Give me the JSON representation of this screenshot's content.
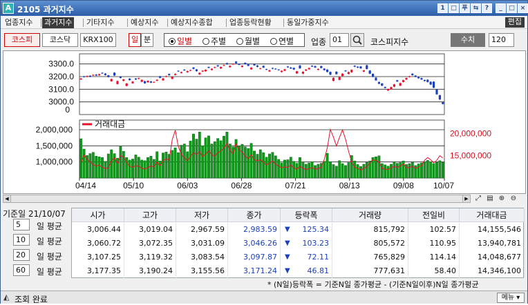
{
  "window": {
    "id": "2105",
    "title": "과거지수",
    "logo_glyph": "A"
  },
  "title_buttons": [
    {
      "name": "screen-num-button",
      "glyph": "1"
    },
    {
      "name": "layout-button",
      "glyph": "□"
    },
    {
      "name": "print-button",
      "glyph": "푸"
    },
    {
      "name": "link-button",
      "glyph": "⇆"
    },
    {
      "name": "help-button",
      "glyph": "?"
    },
    {
      "name": "minimize-button",
      "glyph": "_"
    },
    {
      "name": "maximize-button",
      "glyph": "□"
    },
    {
      "name": "close-button",
      "glyph": "×"
    }
  ],
  "menu_tabs": [
    "업종지수",
    "과거지수",
    "기타지수",
    "예상지수",
    "예상지수종합",
    "업종등락현황",
    "동일가중지수"
  ],
  "menu_active": 1,
  "edit_label": "편집",
  "markets": [
    "코스피",
    "코스닥",
    "KRX100"
  ],
  "market_selected": 0,
  "period_buttons": [
    "일",
    "분"
  ],
  "period_selected": 0,
  "radio_options": [
    "일별",
    "주별",
    "월별",
    "연별"
  ],
  "radio_selected": 0,
  "sector_label": "업종",
  "sector_code": "01",
  "sector_name": "코스피지수",
  "value_button": "수치",
  "count_value": "120",
  "chart_data": [
    {
      "type": "candlestick",
      "title": "",
      "y_ticks": [
        "3300.0",
        "3200.0",
        "3100.0",
        "3000.0",
        "0"
      ],
      "ylim": [
        2900,
        3380
      ],
      "x_labels": [
        "04/14",
        "05/10",
        "06/03",
        "06/28",
        "07/21",
        "08/13",
        "09/08",
        "10/07"
      ],
      "closes": [
        3185,
        3196,
        3205,
        3198,
        3214,
        3208,
        3219,
        3225,
        3212,
        3196,
        3181,
        3209,
        3165,
        3189,
        3178,
        3146,
        3172,
        3161,
        3177,
        3188,
        3174,
        3147,
        3167,
        3152,
        3158,
        3175,
        3190,
        3186,
        3204,
        3211,
        3198,
        3222,
        3241,
        3236,
        3249,
        3244,
        3252,
        3261,
        3243,
        3230,
        3247,
        3254,
        3269,
        3262,
        3275,
        3281,
        3276,
        3291,
        3297,
        3285,
        3302,
        3306,
        3293,
        3286,
        3298,
        3285,
        3271,
        3289,
        3277,
        3266,
        3271,
        3255,
        3250,
        3262,
        3258,
        3252,
        3246,
        3258,
        3273,
        3264,
        3256,
        3242,
        3265,
        3238,
        3256,
        3268,
        3279,
        3272,
        3260,
        3268,
        3251,
        3237,
        3215,
        3190,
        3219,
        3196,
        3223,
        3242,
        3236,
        3254,
        3278,
        3271,
        3265,
        3249,
        3260,
        3223,
        3198,
        3170,
        3143,
        3128,
        3110,
        3102,
        3117,
        3139,
        3161,
        3149,
        3172,
        3189,
        3203,
        3211,
        3198,
        3187,
        3177,
        3165,
        3157,
        3137,
        3112,
        3060,
        3019,
        2983
      ],
      "open_offsets": [
        -8,
        6,
        -7,
        9,
        -6,
        8,
        -9,
        5,
        12,
        14,
        -18,
        22,
        -24,
        10,
        -12,
        -20,
        12,
        -14,
        8,
        -6,
        -15,
        16,
        -12,
        10,
        -4,
        -8,
        12,
        -16,
        -6,
        10,
        -16,
        -9,
        5,
        -8,
        6,
        -10,
        -6,
        11,
        14,
        -13,
        -7,
        -12,
        7,
        -10,
        -6,
        8,
        -12,
        -5,
        10,
        -11,
        -6,
        13,
        7,
        -10,
        11,
        12,
        -14,
        10,
        11,
        -5,
        14,
        4,
        -10,
        6,
        5,
        4,
        -10,
        -12,
        7,
        8,
        13,
        -17,
        23,
        -15,
        -9,
        -10,
        7,
        11,
        -7,
        15,
        12,
        18,
        22,
        -24,
        20,
        -22,
        -18,
        6,
        -15,
        -20,
        8,
        7,
        15,
        -10,
        30,
        25,
        24,
        22,
        14,
        18,
        8,
        -12,
        -18,
        -19,
        10,
        -21,
        -15,
        -12,
        -7,
        12,
        10,
        9,
        11,
        8,
        18,
        22,
        48,
        38,
        34,
        14
      ]
    },
    {
      "type": "bar",
      "title": "거래대금",
      "y_ticks": [
        "2,000,000",
        "1,500,000",
        "1,000,000"
      ],
      "right_ticks": [
        "20,000,000",
        "15,000,000"
      ],
      "ylim": [
        500000,
        2300000
      ],
      "series": [
        {
          "name": "",
          "values": [
            1720000,
            1400000,
            1200000,
            1260000,
            1300000,
            1180000,
            1160000,
            1140000,
            1020000,
            1250000,
            1380000,
            1260000,
            1120000,
            1480000,
            1330000,
            1140000,
            1060000,
            1090000,
            1220000,
            1150000,
            1060000,
            1040000,
            1140000,
            1180000,
            1080000,
            1320000,
            1030000,
            1280000,
            1310000,
            1240000,
            1360000,
            1440000,
            1290000,
            1520000,
            1560000,
            1320000,
            1650000,
            1870000,
            1710000,
            1930000,
            1500000,
            1750000,
            1810000,
            1560000,
            1630000,
            1730000,
            1660000,
            1800000,
            1930000,
            1560000,
            1470000,
            1700000,
            1500000,
            1550000,
            1470000,
            1420000,
            1580000,
            1340000,
            1240000,
            1380000,
            1290000,
            1150000,
            1250000,
            1300000,
            1190000,
            1080000,
            970000,
            1060000,
            1070000,
            1150000,
            1020000,
            960000,
            1140000,
            1000000,
            930000,
            970000,
            1010000,
            890000,
            930000,
            960000,
            1020000,
            1270000,
            1010000,
            920000,
            870000,
            1040000,
            950000,
            890000,
            980000,
            1200000,
            1030000,
            920000,
            860000,
            930000,
            990000,
            1030000,
            1140000,
            1160000,
            1190000,
            950000,
            910000,
            870000,
            930000,
            1010000,
            960000,
            980000,
            1030000,
            920000,
            950000,
            990000,
            890000,
            940000,
            970000,
            1010000,
            1050000,
            1000000,
            950000,
            990000,
            1040000,
            990000
          ]
        },
        {
          "name": "거래대금",
          "values": [
            13400000,
            15300000,
            14200000,
            13600000,
            13000000,
            12700000,
            12900000,
            12400000,
            12100000,
            12300000,
            13800000,
            14600000,
            13300000,
            15000000,
            14700000,
            13500000,
            12600000,
            12400000,
            12800000,
            12600000,
            12200000,
            12000000,
            12400000,
            12700000,
            12500000,
            13600000,
            12700000,
            13900000,
            14300000,
            14000000,
            18600000,
            20700000,
            17100000,
            15300000,
            14600000,
            13900000,
            14800000,
            15700000,
            15300000,
            15900000,
            14800000,
            15400000,
            16100000,
            15200000,
            14900000,
            15700000,
            16100000,
            16700000,
            17700000,
            16200000,
            15400000,
            17800000,
            16300000,
            15800000,
            14900000,
            14300000,
            15300000,
            14100000,
            13900000,
            14100000,
            13600000,
            12900000,
            13400000,
            13800000,
            13100000,
            12700000,
            12300000,
            12500000,
            12400000,
            12900000,
            12300000,
            12000000,
            12600000,
            12200000,
            11900000,
            12100000,
            12400000,
            12000000,
            12100000,
            12400000,
            14200000,
            16800000,
            20900000,
            19200000,
            17200000,
            19100000,
            20800000,
            18700000,
            16000000,
            13600000,
            12400000,
            12200000,
            11800000,
            12200000,
            12500000,
            13400000,
            14100000,
            13900000,
            13600000,
            12200000,
            12000000,
            11900000,
            12300000,
            12600000,
            12400000,
            12700000,
            13200000,
            12300000,
            12400000,
            12700000,
            12100000,
            12500000,
            12800000,
            14000000,
            14600000,
            14100000,
            13400000,
            14000000,
            15000000,
            14500000
          ]
        }
      ]
    }
  ],
  "base_date_label": "기준일",
  "base_date": "21/10/07",
  "avg_rows": [
    {
      "n": "5",
      "label": "일 평균",
      "open": "3,006.44",
      "high": "3,019.04",
      "low": "2,967.59",
      "close": "2,983.59",
      "change": "125.34",
      "volume": "815,792",
      "prev_ratio": "102.57",
      "amount": "14,155,546"
    },
    {
      "n": "10",
      "label": "일 평균",
      "open": "3,060.72",
      "high": "3,072.35",
      "low": "3,031.09",
      "close": "3,046.26",
      "change": "103.23",
      "volume": "805,572",
      "prev_ratio": "110.95",
      "amount": "13,940,781"
    },
    {
      "n": "20",
      "label": "일 평균",
      "open": "3,107.25",
      "high": "3,119.32",
      "low": "3,083.54",
      "close": "3,097.87",
      "change": "72.11",
      "volume": "765,829",
      "prev_ratio": "114.14",
      "amount": "14,048,677"
    },
    {
      "n": "60",
      "label": "일 평균",
      "open": "3,177.35",
      "high": "3,190.24",
      "low": "3,155.56",
      "close": "3,171.24",
      "change": "46.81",
      "volume": "777,631",
      "prev_ratio": "58.40",
      "amount": "14,346,100"
    }
  ],
  "columns": [
    "시가",
    "고가",
    "저가",
    "종가",
    "등락폭",
    "거래량",
    "전일비",
    "거래대금"
  ],
  "footnote": "* (N일)등락폭 = 기준N일 종가평균 - (기준N일이후)N일 종가평균",
  "status": {
    "text": "조회 완료",
    "menu_label": "메뉴"
  },
  "colors": {
    "up": "#e8112d",
    "down": "#1a3fbf",
    "bar": "#0f9b1a",
    "bar_edge": "#0a5e10",
    "line": "#e8112d"
  }
}
